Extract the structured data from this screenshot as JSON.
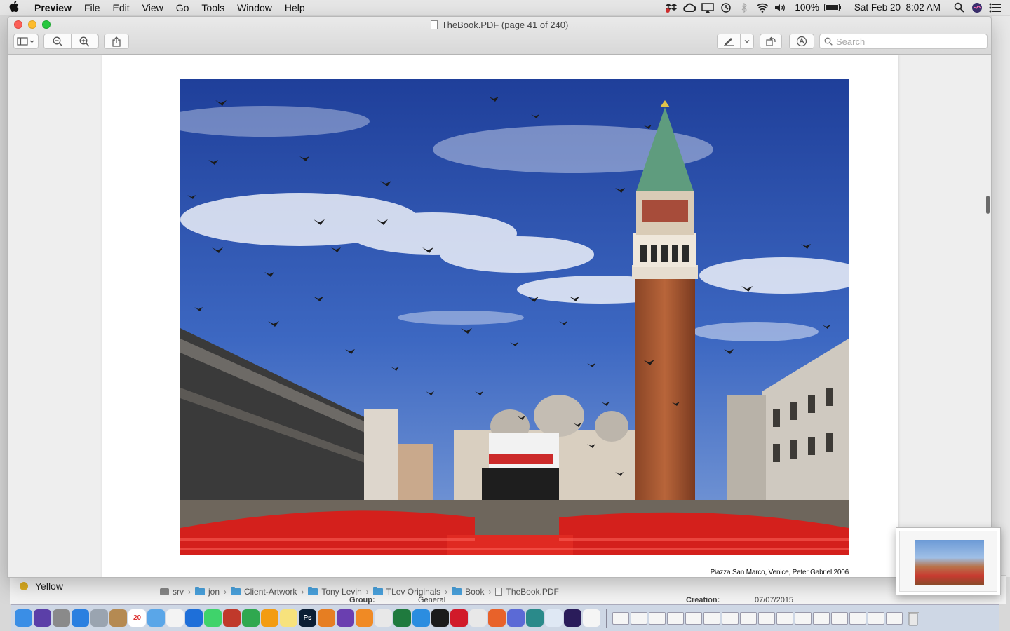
{
  "menubar": {
    "app_name": "Preview",
    "items": [
      "File",
      "Edit",
      "View",
      "Go",
      "Tools",
      "Window",
      "Help"
    ],
    "battery_percent": "100%",
    "battery_level": 1.0,
    "datetime": "Sat Feb 20  8:02 AM",
    "status_icons": [
      "dropbox-icon",
      "creative-cloud-icon",
      "airplay-icon",
      "time-machine-icon",
      "bluetooth-icon",
      "wifi-icon",
      "volume-icon",
      "battery-icon",
      "spotlight-icon",
      "siri-icon",
      "notification-center-icon"
    ]
  },
  "window": {
    "title": "TheBook.PDF (page 41 of 240)",
    "search_placeholder": "Search"
  },
  "document": {
    "caption": "Piazza San Marco, Venice, Peter Gabriel 2006"
  },
  "background": {
    "sidebar_label": "Yellow",
    "path": [
      "srv",
      "jon",
      "Client-Artwork",
      "Tony Levin",
      "TLev Originals",
      "Book",
      "TheBook.PDF"
    ],
    "ghost_group": "Group:",
    "ghost_general": "General",
    "ghost_creation": "Creation:",
    "ghost_date": "07/07/2015"
  },
  "dock": {
    "apps": [
      {
        "name": "finder",
        "color": "#3a8ee6",
        "glyph": ""
      },
      {
        "name": "siri",
        "color": "#5b3fa8",
        "glyph": ""
      },
      {
        "name": "system-preferences",
        "color": "#8a8a8a",
        "glyph": ""
      },
      {
        "name": "safari",
        "color": "#2a7fe0",
        "glyph": ""
      },
      {
        "name": "launchpad",
        "color": "#9aa4b0",
        "glyph": ""
      },
      {
        "name": "contacts",
        "color": "#b58a52",
        "glyph": ""
      },
      {
        "name": "calendar",
        "color": "#ffffff",
        "glyph": "20"
      },
      {
        "name": "mail",
        "color": "#5aa6e8",
        "glyph": ""
      },
      {
        "name": "photos",
        "color": "#f3f3f3",
        "glyph": ""
      },
      {
        "name": "xcode",
        "color": "#1e6fd9",
        "glyph": ""
      },
      {
        "name": "messages",
        "color": "#3fd36b",
        "glyph": ""
      },
      {
        "name": "photo-booth",
        "color": "#c0392b",
        "glyph": ""
      },
      {
        "name": "numbers",
        "color": "#2fa84f",
        "glyph": ""
      },
      {
        "name": "pages",
        "color": "#f39c12",
        "glyph": ""
      },
      {
        "name": "notes",
        "color": "#f7e27c",
        "glyph": ""
      },
      {
        "name": "photoshop",
        "color": "#0b1e33",
        "glyph": "Ps"
      },
      {
        "name": "books-app",
        "color": "#e67e22",
        "glyph": ""
      },
      {
        "name": "imovie",
        "color": "#6a3fb0",
        "glyph": ""
      },
      {
        "name": "ibooks",
        "color": "#f08a24",
        "glyph": ""
      },
      {
        "name": "itunes",
        "color": "#e8e8e8",
        "glyph": ""
      },
      {
        "name": "excel",
        "color": "#1f7a3e",
        "glyph": ""
      },
      {
        "name": "app-store",
        "color": "#2b8de0",
        "glyph": ""
      },
      {
        "name": "terminal",
        "color": "#1b1b1b",
        "glyph": ""
      },
      {
        "name": "opera",
        "color": "#d11a2a",
        "glyph": ""
      },
      {
        "name": "chrome",
        "color": "#e8e8e8",
        "glyph": ""
      },
      {
        "name": "firefox",
        "color": "#e8622a",
        "glyph": ""
      },
      {
        "name": "bbedit",
        "color": "#5b6ad6",
        "glyph": ""
      },
      {
        "name": "sketch",
        "color": "#2a8a8a",
        "glyph": ""
      },
      {
        "name": "preview",
        "color": "#dfe8f4",
        "glyph": ""
      },
      {
        "name": "amazon-music",
        "color": "#2a1c5a",
        "glyph": ""
      },
      {
        "name": "textedit",
        "color": "#f5f5f5",
        "glyph": ""
      }
    ],
    "trash": {
      "name": "trash"
    }
  },
  "colors": {
    "accent": "#3a8ee6",
    "close": "#fc5f57",
    "minimize": "#fdbc2e",
    "zoom": "#28c840"
  }
}
